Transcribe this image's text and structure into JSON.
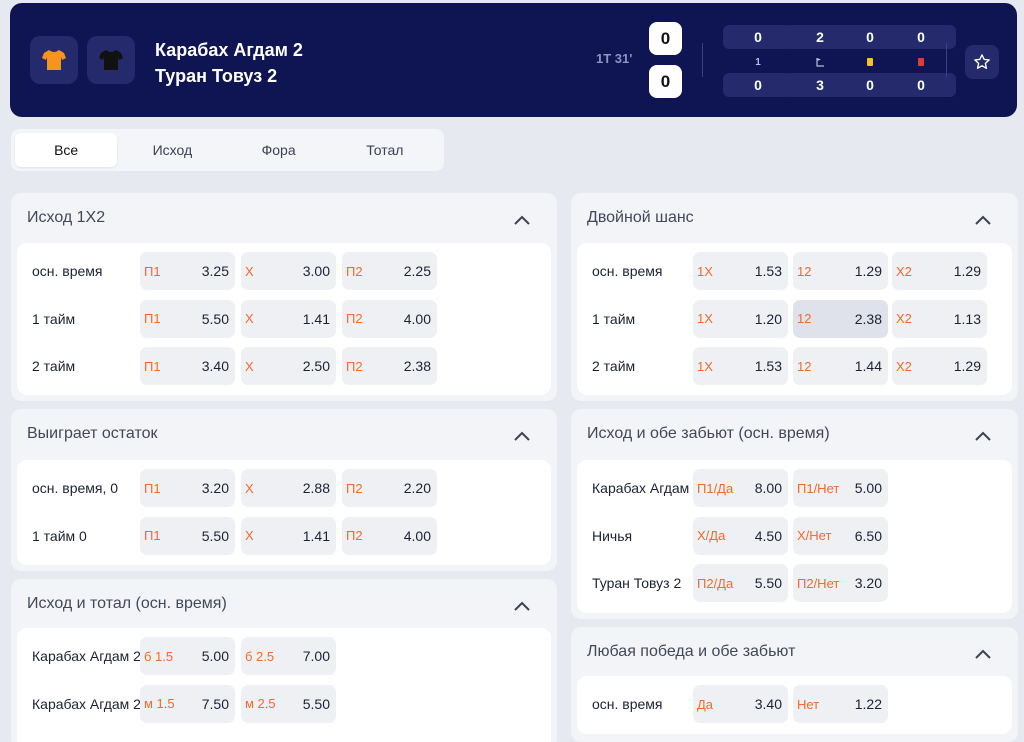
{
  "match": {
    "team1": "Карабах Агдам 2",
    "team2": "Туран Товуз 2",
    "time": "1Т 31'",
    "score1": "0",
    "score2": "0",
    "stats": [
      {
        "top": "0",
        "mid": "1",
        "bottom": "0"
      },
      {
        "top": "2",
        "mid": "corner-icon",
        "bottom": "3"
      },
      {
        "top": "0",
        "mid": "yellow-card-icon",
        "bottom": "0"
      },
      {
        "top": "0",
        "mid": "red-card-icon",
        "bottom": "0"
      }
    ],
    "team1_color": "#f7941d",
    "team2_color": "#111111"
  },
  "tabs": [
    "Все",
    "Исход",
    "Фора",
    "Тотал"
  ],
  "markets": {
    "outcome": {
      "title": "Исход 1X2",
      "rows": [
        {
          "label": "осн. время",
          "odds": [
            {
              "k": "П1",
              "v": "3.25"
            },
            {
              "k": "X",
              "v": "3.00"
            },
            {
              "k": "П2",
              "v": "2.25"
            }
          ]
        },
        {
          "label": "1 тайм",
          "odds": [
            {
              "k": "П1",
              "v": "5.50"
            },
            {
              "k": "X",
              "v": "1.41"
            },
            {
              "k": "П2",
              "v": "4.00"
            }
          ]
        },
        {
          "label": "2 тайм",
          "odds": [
            {
              "k": "П1",
              "v": "3.40"
            },
            {
              "k": "X",
              "v": "2.50"
            },
            {
              "k": "П2",
              "v": "2.38"
            }
          ]
        }
      ]
    },
    "remainder": {
      "title": "Выиграет остаток",
      "rows": [
        {
          "label": "осн. время, 0",
          "odds": [
            {
              "k": "П1",
              "v": "3.20"
            },
            {
              "k": "X",
              "v": "2.88"
            },
            {
              "k": "П2",
              "v": "2.20"
            }
          ]
        },
        {
          "label": "1 тайм 0",
          "odds": [
            {
              "k": "П1",
              "v": "5.50"
            },
            {
              "k": "X",
              "v": "1.41"
            },
            {
              "k": "П2",
              "v": "4.00"
            }
          ]
        }
      ]
    },
    "outcome_total": {
      "title": "Исход и тотал (осн. время)",
      "rows": [
        {
          "label": "Карабах Агдам 2",
          "odds": [
            {
              "k": "б 1.5",
              "v": "5.00"
            },
            {
              "k": "б 2.5",
              "v": "7.00"
            }
          ]
        },
        {
          "label": "Карабах Агдам 2",
          "odds": [
            {
              "k": "м 1.5",
              "v": "7.50"
            },
            {
              "k": "м 2.5",
              "v": "5.50"
            }
          ]
        }
      ]
    },
    "double_chance": {
      "title": "Двойной шанс",
      "rows": [
        {
          "label": "осн. время",
          "odds": [
            {
              "k": "1X",
              "v": "1.53"
            },
            {
              "k": "12",
              "v": "1.29"
            },
            {
              "k": "X2",
              "v": "1.29"
            }
          ]
        },
        {
          "label": "1 тайм",
          "odds": [
            {
              "k": "1X",
              "v": "1.20"
            },
            {
              "k": "12",
              "v": "2.38"
            },
            {
              "k": "X2",
              "v": "1.13"
            }
          ]
        },
        {
          "label": "2 тайм",
          "odds": [
            {
              "k": "1X",
              "v": "1.53"
            },
            {
              "k": "12",
              "v": "1.44"
            },
            {
              "k": "X2",
              "v": "1.29"
            }
          ]
        }
      ]
    },
    "outcome_btts": {
      "title": "Исход и обе забьют (осн. время)",
      "rows": [
        {
          "label": "Карабах Агдам 2",
          "odds": [
            {
              "k": "П1/Да",
              "v": "8.00"
            },
            {
              "k": "П1/Нет",
              "v": "5.00"
            }
          ]
        },
        {
          "label": "Ничья",
          "odds": [
            {
              "k": "X/Да",
              "v": "4.50"
            },
            {
              "k": "X/Нет",
              "v": "6.50"
            }
          ]
        },
        {
          "label": "Туран Товуз 2",
          "odds": [
            {
              "k": "П2/Да",
              "v": "5.50"
            },
            {
              "k": "П2/Нет",
              "v": "3.20"
            }
          ]
        }
      ]
    },
    "any_win_btts": {
      "title": "Любая победа и обе забьют",
      "rows": [
        {
          "label": "осн. время",
          "odds": [
            {
              "k": "Да",
              "v": "3.40"
            },
            {
              "k": "Нет",
              "v": "1.22"
            }
          ]
        }
      ]
    }
  }
}
